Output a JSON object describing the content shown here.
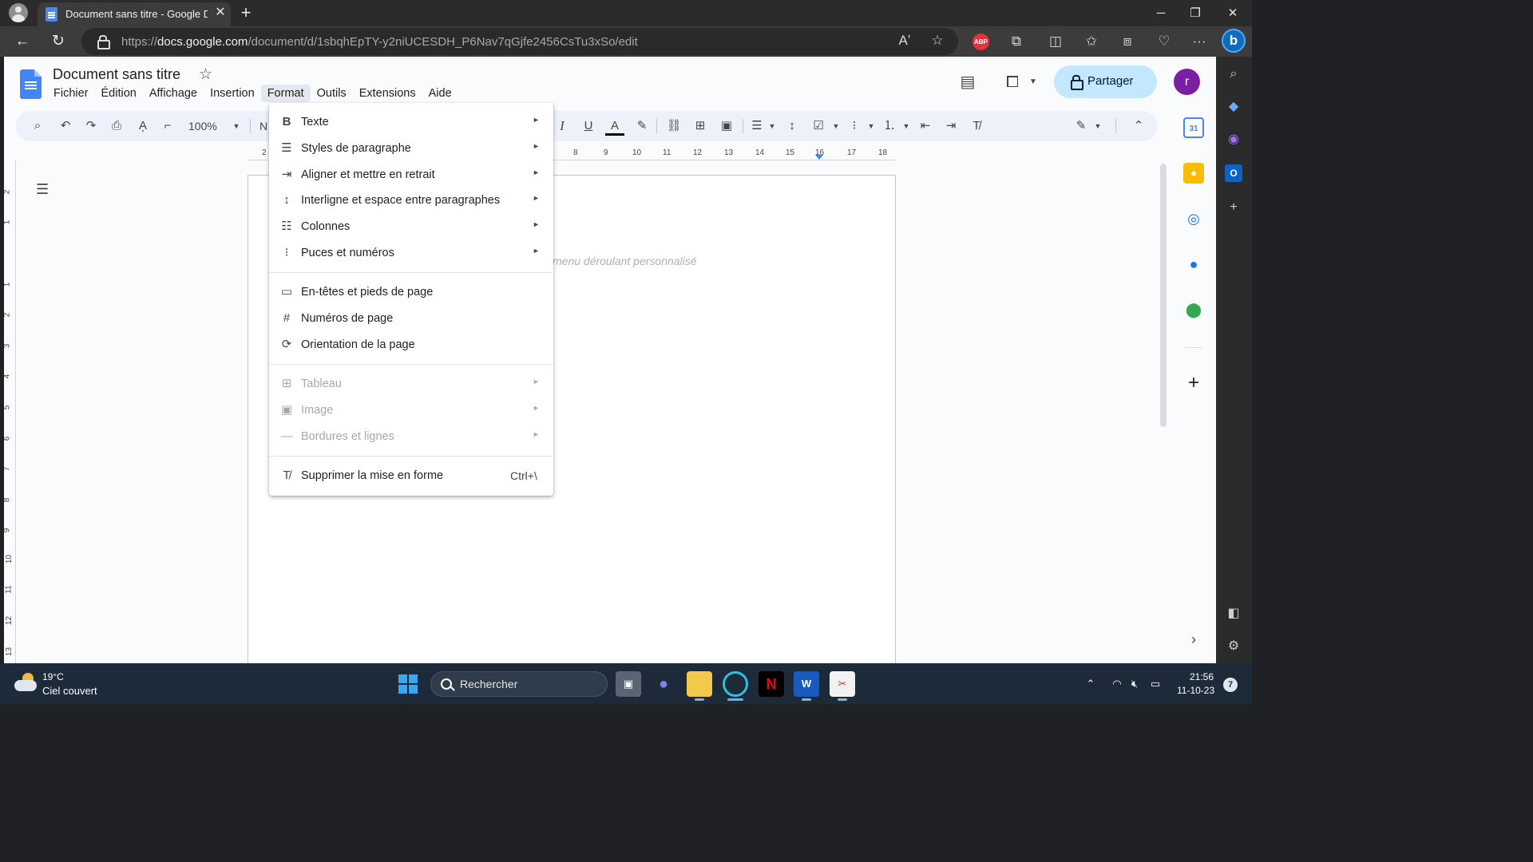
{
  "browser": {
    "tab_title": "Document sans titre - Google Docs",
    "url_scheme": "https://",
    "url_domain": "docs.google.com",
    "url_path": "/document/d/1sbqhEpTY-y2niUCESDH_P6Nav7qGjfe2456CsTu3xSo/edit",
    "adblock_label": "ABP",
    "bing_label": "b"
  },
  "docs": {
    "title": "Document sans titre",
    "menus": [
      "Fichier",
      "Édition",
      "Affichage",
      "Insertion",
      "Format",
      "Outils",
      "Extensions",
      "Aide"
    ],
    "active_menu": "Format",
    "share_label": "Partager",
    "avatar_letter": "r",
    "zoom": "100%",
    "style_partial": "N",
    "placeholder": "menu déroulant personnalisé",
    "ruler_top": [
      "2",
      "8",
      "9",
      "10",
      "11",
      "12",
      "13",
      "14",
      "15",
      "16",
      "17",
      "18"
    ],
    "ruler_left": [
      "2",
      "1",
      "1",
      "2",
      "3",
      "4",
      "5",
      "6",
      "7",
      "8",
      "9",
      "10",
      "11",
      "12",
      "13"
    ]
  },
  "format_menu": {
    "texte": "Texte",
    "styles": "Styles de paragraphe",
    "aligner": "Aligner et mettre en retrait",
    "interligne": "Interligne et espace entre paragraphes",
    "colonnes": "Colonnes",
    "puces": "Puces et numéros",
    "entetes": "En-têtes et pieds de page",
    "numeros": "Numéros de page",
    "orientation": "Orientation de la page",
    "tableau": "Tableau",
    "image": "Image",
    "bordures": "Bordures et lignes",
    "supprimer": "Supprimer la mise en forme",
    "supprimer_shortcut": "Ctrl+\\"
  },
  "taskbar": {
    "temperature": "19°C",
    "weather": "Ciel couvert",
    "search_label": "Rechercher",
    "time": "21:56",
    "date": "11-10-23",
    "notifications": "7",
    "netflix_label": "N",
    "word_label": "W"
  },
  "colors": {
    "accent_blue": "#4285f4",
    "share_bg": "#c2e7ff",
    "avatar_purple": "#7b1fa2",
    "menu_active_bg": "#e3e8f1"
  }
}
